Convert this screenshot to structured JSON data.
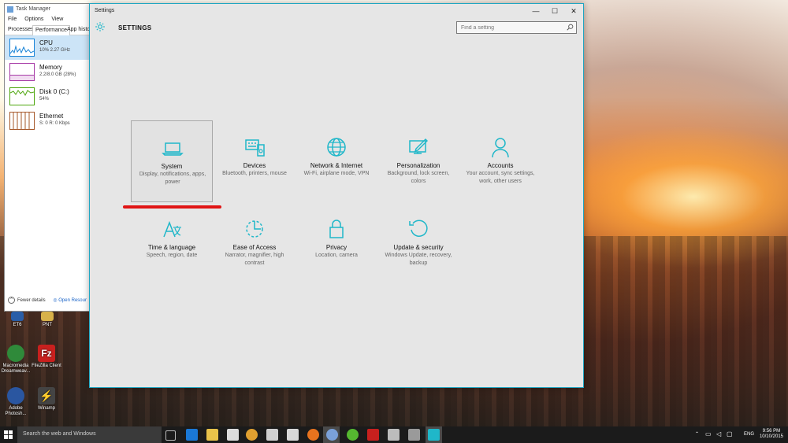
{
  "task_manager": {
    "title": "Task Manager",
    "menu": [
      "File",
      "Options",
      "View"
    ],
    "tabs": [
      "Processes",
      "Performance",
      "App histor"
    ],
    "items": [
      {
        "name": "CPU",
        "value": "10% 2.27 GHz",
        "color": "#1883d7"
      },
      {
        "name": "Memory",
        "value": "2.2/8.0 GB (28%)",
        "color": "#a63aa6"
      },
      {
        "name": "Disk 0 (C:)",
        "value": "54%",
        "color": "#4da60c"
      },
      {
        "name": "Ethernet",
        "value": "S: 0 R: 0 Kbps",
        "color": "#a6582a"
      }
    ],
    "fewer_details": "Fewer details",
    "open_resource": "Open Resour"
  },
  "desktop_icons": [
    {
      "label": "ET6",
      "color": "#2a5ea8"
    },
    {
      "label": "PNT",
      "color": "#d8b24a"
    },
    {
      "label": "Macromedia Dreamweav...",
      "color": "#2f8a3a"
    },
    {
      "label": "FileZilla Client",
      "color": "#c8201e"
    },
    {
      "label": "Adobe Photosh...",
      "color": "#2a56a0"
    },
    {
      "label": "Winamp",
      "color": "#444444"
    }
  ],
  "settings": {
    "window_title": "Settings",
    "heading": "SETTINGS",
    "search_placeholder": "Find a setting",
    "accent": "#1fb7c9",
    "controls": {
      "minimize": "—",
      "maximize": "☐",
      "close": "✕"
    },
    "tiles": [
      {
        "name": "System",
        "desc": "Display, notifications, apps, power",
        "icon": "laptop-icon"
      },
      {
        "name": "Devices",
        "desc": "Bluetooth, printers, mouse",
        "icon": "devices-icon"
      },
      {
        "name": "Network & Internet",
        "desc": "Wi-Fi, airplane mode, VPN",
        "icon": "globe-icon"
      },
      {
        "name": "Personalization",
        "desc": "Background, lock screen, colors",
        "icon": "personalization-icon"
      },
      {
        "name": "Accounts",
        "desc": "Your account, sync settings, work, other users",
        "icon": "person-icon"
      },
      {
        "name": "Time & language",
        "desc": "Speech, region, date",
        "icon": "time-language-icon"
      },
      {
        "name": "Ease of Access",
        "desc": "Narrator, magnifier, high contrast",
        "icon": "ease-of-access-icon"
      },
      {
        "name": "Privacy",
        "desc": "Location, camera",
        "icon": "lock-icon"
      },
      {
        "name": "Update & security",
        "desc": "Windows Update, recovery, backup",
        "icon": "update-icon"
      }
    ]
  },
  "taskbar": {
    "search_text": "Search the web and Windows",
    "language": "ENG",
    "time": "9:56 PM",
    "date": "10/10/2015",
    "apps": [
      {
        "name": "task-view-icon",
        "color": "#1b1b1b"
      },
      {
        "name": "edge-icon",
        "color": "#1a78d6"
      },
      {
        "name": "file-explorer-icon",
        "color": "#e8c24a"
      },
      {
        "name": "store-icon",
        "color": "#dcdcdc"
      },
      {
        "name": "chrome-icon",
        "color": "#e0a030"
      },
      {
        "name": "folder-icon",
        "color": "#cfcfcf"
      },
      {
        "name": "media-icon",
        "color": "#d8d8d8"
      },
      {
        "name": "firefox-icon",
        "color": "#e8731e"
      },
      {
        "name": "app-icon",
        "color": "#7aa0d8"
      },
      {
        "name": "green-app-icon",
        "color": "#55b830"
      },
      {
        "name": "filezilla-icon",
        "color": "#c8201e"
      },
      {
        "name": "window-icon",
        "color": "#bcbcbc"
      },
      {
        "name": "gray-app-icon",
        "color": "#9a9a9a"
      },
      {
        "name": "settings-gear-icon",
        "color": "#1fb7c9"
      }
    ]
  }
}
